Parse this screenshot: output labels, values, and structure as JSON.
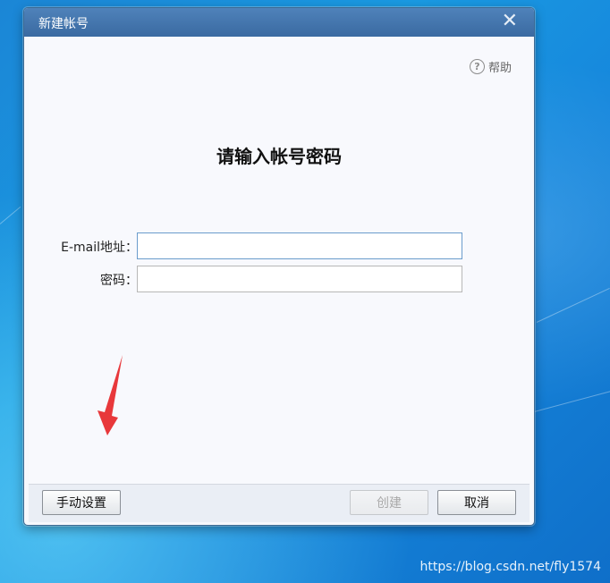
{
  "window": {
    "title": "新建帐号",
    "close_icon": "close-icon"
  },
  "help": {
    "icon": "question-circle-icon",
    "label": "帮助"
  },
  "heading": "请输入帐号密码",
  "form": {
    "email_label": "E-mail地址：",
    "email_value": "",
    "password_label": "密码：",
    "password_value": ""
  },
  "footer": {
    "manual_setup": "手动设置",
    "create": "创建",
    "create_enabled": false,
    "cancel": "取消"
  },
  "annotation": {
    "arrow_icon": "red-arrow-icon",
    "color": "#e8383b"
  },
  "watermark": "https://blog.csdn.net/fly1574"
}
